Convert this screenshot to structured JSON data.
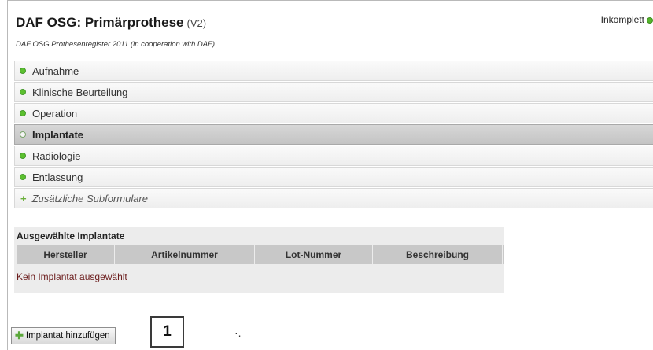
{
  "header": {
    "title": "DAF OSG: Primärprothese",
    "version": "(V2)",
    "subtitle": "DAF OSG Prothesenregister 2011 (in cooperation with DAF)",
    "status": "Inkomplett",
    "status_color": "#55b52d"
  },
  "nav": {
    "items": [
      {
        "label": "Aufnahme"
      },
      {
        "label": "Klinische Beurteilung"
      },
      {
        "label": "Operation"
      },
      {
        "label": "Implantate"
      },
      {
        "label": "Radiologie"
      },
      {
        "label": "Entlassung"
      }
    ],
    "active": "Implantate",
    "extra_label": "Zusätzliche Subformulare"
  },
  "implants": {
    "title": "Ausgewählte Implantate",
    "columns": [
      "Hersteller",
      "Artikelnummer",
      "Lot-Nummer",
      "Beschreibung"
    ],
    "empty_message": "Kein Implantat ausgewählt"
  },
  "actions": {
    "add_label": "Implantat hinzufügen",
    "step_number": "1",
    "mark": "·."
  },
  "colors": {
    "bullet": "#5cc02f",
    "active_row": "#c4c4c4",
    "empty_text": "#6b1c1c"
  },
  "icons": {
    "status": "status-dot-icon",
    "nav_bullet": "bullet-dot-icon",
    "add": "plus-icon"
  }
}
